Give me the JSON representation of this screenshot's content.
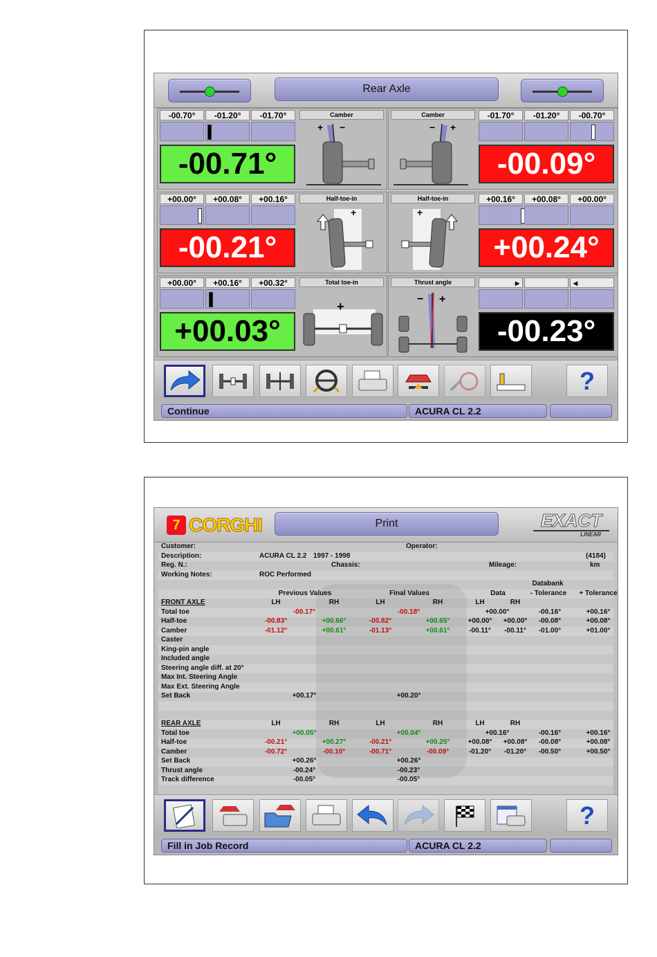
{
  "screen1": {
    "title": "Rear Axle",
    "cells": {
      "camber_l": {
        "label": "Camber",
        "scale": [
          "-00.70°",
          "-01.20°",
          "-01.70°"
        ],
        "value": "-00.71°"
      },
      "camber_r": {
        "label": "Camber",
        "scale": [
          "-01.70°",
          "-01.20°",
          "-00.70°"
        ],
        "value": "-00.09°"
      },
      "halftoe_l": {
        "label": "Half-toe-in",
        "scale": [
          "+00.00°",
          "+00.08°",
          "+00.16°"
        ],
        "value": "-00.21°"
      },
      "halftoe_r": {
        "label": "Half-toe-in",
        "scale": [
          "+00.16°",
          "+00.08°",
          "+00.00°"
        ],
        "value": "+00.24°"
      },
      "totaltoe": {
        "label": "Total toe-in",
        "scale": [
          "+00.00°",
          "+00.16°",
          "+00.32°"
        ],
        "value": "+00.03°"
      },
      "thrust": {
        "label": "Thrust angle",
        "scale": [
          "",
          "",
          ""
        ],
        "value": "-00.23°"
      }
    },
    "toolbar_icons": [
      "arrow-forward-icon",
      "front-axle-icon",
      "rear-axle-icon",
      "steering-wheel-icon",
      "printer-icon",
      "car-lift-icon",
      "wrench-wheel-icon",
      "chart-bars-icon",
      "help-icon"
    ],
    "help_glyph": "?",
    "status": {
      "left": "Continue",
      "mid": "ACURA CL 2.2",
      "right": ""
    },
    "colors": {
      "ok": "#66ee44",
      "bad": "#ff1111",
      "neutral": "#000000"
    }
  },
  "screen2": {
    "title": "Print",
    "logo": "CORGHI",
    "brand": "EXACT",
    "brand_sub": "LINEAR",
    "header": {
      "customer": "Customer:",
      "operator": "Operator:",
      "description": "Description:",
      "description_value": "ACURA CL 2.2",
      "years": "1997 - 1998",
      "code": "(4184)",
      "reg": "Reg. N.:",
      "chassis": "Chassis:",
      "mileage": "Mileage:",
      "km": "km",
      "notes": "Working Notes:",
      "notes_value": "ROC Performed"
    },
    "columns": {
      "previous": "Previous Values",
      "final": "Final Values",
      "databank": "Databank",
      "data": "Data",
      "minus_tol": "- Tolerance",
      "plus_tol": "+ Tolerance",
      "lh": "LH",
      "rh": "RH"
    },
    "front_axle": {
      "heading": "FRONT AXLE",
      "rows": [
        {
          "label": "Total toe",
          "prev_mid": "-00.17°",
          "fin_mid": "-00.18°",
          "data_mid": "+00.00°",
          "tol_m": "-00.16°",
          "tol_p": "+00.16°"
        },
        {
          "label": "Half-toe",
          "prev_lh": "-00.83°",
          "prev_rh": "+00.66°",
          "fin_lh": "-00.82°",
          "fin_rh": "+00.65°",
          "data_lh": "+00.00°",
          "data_rh": "+00.00°",
          "tol_m": "-00.08°",
          "tol_p": "+00.08°"
        },
        {
          "label": "Camber",
          "prev_lh": "-01.12°",
          "prev_rh": "+00.61°",
          "fin_lh": "-01.13°",
          "fin_rh": "+00.61°",
          "data_lh": "-00.11°",
          "data_rh": "-00.11°",
          "tol_m": "-01.00°",
          "tol_p": "+01.00°"
        },
        {
          "label": "Caster"
        },
        {
          "label": "King-pin angle"
        },
        {
          "label": "Included angle"
        },
        {
          "label": "Steering angle diff. at 20°"
        },
        {
          "label": "Max Int. Steering Angle"
        },
        {
          "label": "Max Ext. Steering Angle"
        },
        {
          "label": "Set Back",
          "prev_mid": "+00.17°",
          "fin_mid": "+00.20°"
        }
      ]
    },
    "rear_axle": {
      "heading": "REAR AXLE",
      "rows": [
        {
          "label": "Total toe",
          "prev_mid": "+00.05°",
          "fin_mid": "+00.04°",
          "data_mid": "+00.16°",
          "tol_m": "-00.16°",
          "tol_p": "+00.16°"
        },
        {
          "label": "Half-toe",
          "prev_lh": "-00.21°",
          "prev_rh": "+00.27°",
          "fin_lh": "-00.21°",
          "fin_rh": "+00.25°",
          "data_lh": "+00.08°",
          "data_rh": "+00.08°",
          "tol_m": "-00.08°",
          "tol_p": "+00.08°"
        },
        {
          "label": "Camber",
          "prev_lh": "-00.72°",
          "prev_rh": "-00.10°",
          "fin_lh": "-00.71°",
          "fin_rh": "-00.09°",
          "data_lh": "-01.20°",
          "data_rh": "-01.20°",
          "tol_m": "-00.50°",
          "tol_p": "+00.50°"
        },
        {
          "label": "Set Back",
          "prev_mid": "+00.26°",
          "fin_mid": "+00.26°"
        },
        {
          "label": "Thrust angle",
          "prev_mid": "-00.24°",
          "fin_mid": "-00.23°"
        },
        {
          "label": "Track difference",
          "prev_mid": "-00.05°",
          "fin_mid": "-00.05°"
        }
      ]
    },
    "toolbar_icons": [
      "edit-document-icon",
      "print-car-icon",
      "open-folder-car-icon",
      "printer-icon",
      "back-arrow-icon",
      "forward-arrow-icon",
      "checkered-flag-icon",
      "print-preview-icon",
      "help-icon"
    ],
    "help_glyph": "?",
    "status": {
      "left": "Fill in Job Record",
      "mid": "ACURA CL 2.2",
      "right": ""
    }
  }
}
